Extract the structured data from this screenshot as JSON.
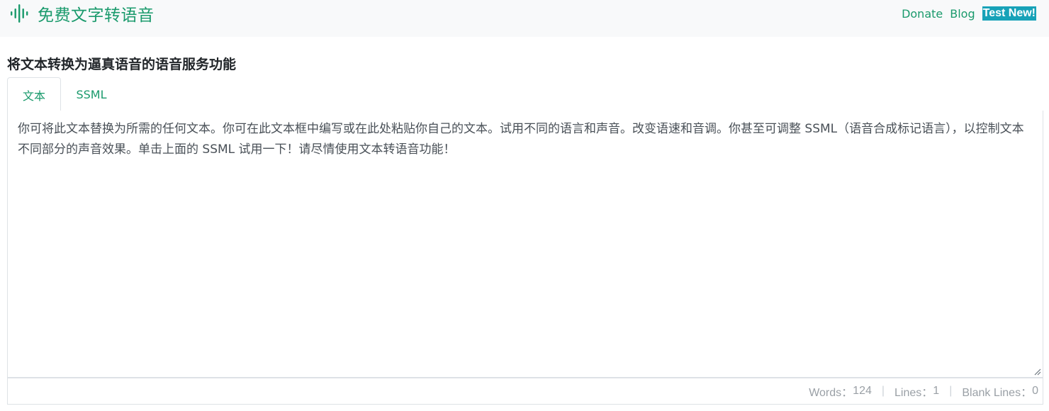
{
  "navbar": {
    "brand_icon": "sound-wave-icon",
    "brand_title": "免费文字转语音",
    "links": {
      "donate": "Donate",
      "blog": "Blog",
      "test_new": "Test New!"
    }
  },
  "main": {
    "heading": "将文本转换为逼真语音的语音服务功能",
    "tabs": [
      {
        "label": "文本",
        "active": true
      },
      {
        "label": "SSML",
        "active": false
      }
    ],
    "editor": {
      "text": "你可将此文本替换为所需的任何文本。你可在此文本框中编写或在此处粘贴你自己的文本。试用不同的语言和声音。改变语速和音调。你甚至可调整 SSML（语音合成标记语言），以控制文本不同部分的声音效果。单击上面的 SSML 试用一下！请尽情使用文本转语音功能！"
    },
    "stats": {
      "words_label": "Words：",
      "words_value": "124",
      "lines_label": "Lines：",
      "lines_value": "1",
      "blank_label": "Blank Lines：",
      "blank_value": "0",
      "separator": "|"
    }
  },
  "colors": {
    "brand_green": "#1a9a6c",
    "badge_teal": "#17a2b8",
    "navbar_bg": "#f8f9fa",
    "border": "#dee2e6"
  }
}
